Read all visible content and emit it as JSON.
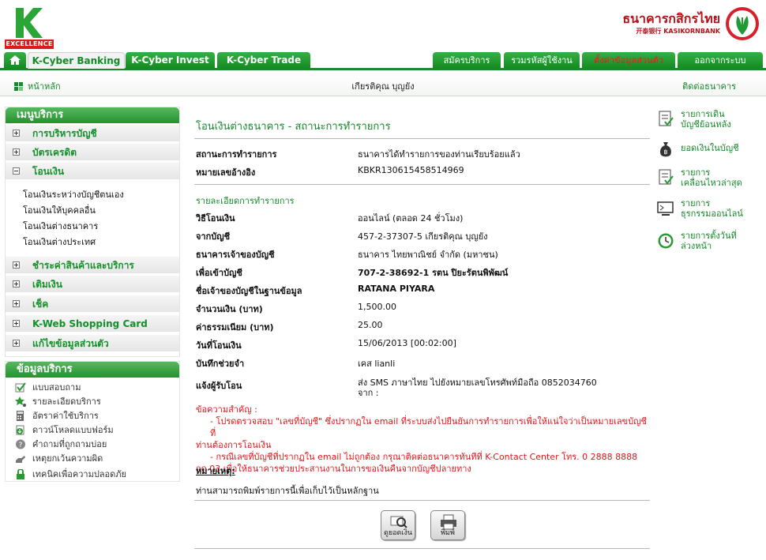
{
  "header": {
    "logo_excellence": "EXCELLENCE",
    "bank_name_th": "ธนาคารกสิกรไทย",
    "bank_name_en": "开泰银行 KASIKORNBANK",
    "colors": {
      "brand_green": "#148a22",
      "accent_red": "#e81c1c"
    }
  },
  "tabs": [
    {
      "label": "K-Cyber Banking"
    },
    {
      "label": "K-Cyber Invest"
    },
    {
      "label": "K-Cyber Trade"
    },
    {
      "label": "สมัครบริการ"
    },
    {
      "label": "รวมรหัสผู้ใช้งาน"
    },
    {
      "label": "ตั้งค่าข้อมูลส่วนตัว"
    },
    {
      "label": "ออกจากระบบ"
    }
  ],
  "subbar": {
    "home": "หน้าหลัก",
    "user_name": "เกียรติคุณ บุญยัง",
    "contact": "ติดต่อธนาคาร"
  },
  "sidebar": {
    "menu_title": "เมนูบริการ",
    "menu": [
      {
        "label": "การบริหารบัญชี",
        "state": "collapsed"
      },
      {
        "label": "บัตรเครดิต",
        "state": "collapsed"
      },
      {
        "label": "โอนเงิน",
        "state": "expanded"
      },
      {
        "label": "ชำระค่าสินค้าและบริการ",
        "state": "collapsed"
      },
      {
        "label": "เติมเงิน",
        "state": "collapsed"
      },
      {
        "label": "เช็ค",
        "state": "collapsed"
      },
      {
        "label": "K-Web Shopping Card",
        "state": "collapsed"
      },
      {
        "label": "แก้ไขข้อมูลส่วนตัว",
        "state": "collapsed"
      }
    ],
    "transfer_sub": [
      "โอนเงินระหว่างบัญชีตนเอง",
      "โอนเงินให้บุคคลอื่น",
      "โอนเงินต่างธนาคาร",
      "โอนเงินต่างประเทศ"
    ],
    "info_title": "ข้อมูลบริการ",
    "info": [
      {
        "label": "แบบสอบถาม",
        "icon": "checkmark-icon"
      },
      {
        "label": "รายละเอียดบริการ",
        "icon": "star-icon"
      },
      {
        "label": "อัตราค่าใช้บริการ",
        "icon": "calculator-icon"
      },
      {
        "label": "ดาวน์โหลดแบบฟอร์ม",
        "icon": "download-icon"
      },
      {
        "label": "คำถามที่ถูกถามบ่อย",
        "icon": "question-icon"
      },
      {
        "label": "เหตุยกเว้นความผิด",
        "icon": "hand-icon"
      },
      {
        "label": "เทคนิคเพื่อความปลอดภัย",
        "icon": "lock-icon"
      }
    ]
  },
  "main": {
    "title": "โอนเงินต่างธนาคาร - สถานะการทำรายการ",
    "status_label": "สถานะการทำรายการ",
    "status_value": "ธนาคารได้ทำรายการของท่านเรียบร้อยแล้ว",
    "ref_label": "หมายเลขอ้างอิง",
    "ref_value": "KBKR130615458514969",
    "details_title": "รายละเอียดการทำรายการ",
    "details": [
      {
        "label": "วิธีโอนเงิน",
        "value": "ออนไลน์ (ตลอด 24 ชั่วโมง)"
      },
      {
        "label": "จากบัญชี",
        "value": "457-2-37307-5 เกียรติคุณ บุญยัง"
      },
      {
        "label": "ธนาคารเจ้าของบัญชี",
        "value": "ธนาคาร ไทยพาณิชย์ จำกัด (มหาชน)"
      },
      {
        "label": "เพื่อเข้าบัญชี",
        "value": "707-2-38692-1 รตน ปิยะรัตนพิพัฒน์"
      },
      {
        "label": "ชื่อเจ้าของบัญชีในฐานข้อมูล",
        "value": "RATANA PIYARA"
      },
      {
        "label": "จำนวนเงิน (บาท)",
        "value": "1,500.00"
      },
      {
        "label": "ค่าธรรมเนียม (บาท)",
        "value": "25.00"
      },
      {
        "label": "วันที่โอนเงิน",
        "value": "15/06/2013 [00:02:00]"
      },
      {
        "label": "บันทึกช่วยจำ",
        "value": "เคส lianli"
      },
      {
        "label": "แจ้งผู้รับโอน",
        "value": "ส่ง SMS ภาษาไทย ไปยังหมายเลขโทรศัพท์มือถือ 0852034760",
        "value2": "จาก :"
      }
    ],
    "warning_head": "ข้อความสำคัญ :",
    "warning_1": "- โปรดตรวจสอบ \"เลขที่บัญชี\" ซึ่งปรากฏใน email ที่ระบบส่งไปยืนยันการทำรายการเพื่อให้แน่ใจว่าเป็นหมายเลขบัญชีที่",
    "warning_1b": "ท่านต้องการโอนเงิน",
    "warning_2": "- กรณีเลขที่บัญชีที่ปรากฏใน email ไม่ถูกต้อง กรุณาติดต่อธนาคารทันทีที่ K-Contact Center โทร. 0 2888 8888",
    "warning_2b": "กด 03 เพื่อให้ธนาคารช่วยประสานงานในการขอเงินคืนจากบัญชีปลายทาง",
    "note_head": "หมายเหตุ:",
    "note_body": "ท่านสามารถพิมพ์รายการนี้เพื่อเก็บไว้เป็นหลักฐาน",
    "btn_check_balance": "ดูยอดเงิน",
    "btn_print": "พิมพ์"
  },
  "quick_links": [
    {
      "line1": "รายการเดิน",
      "line2": "บัญชีย้อนหลัง",
      "icon": "statement-icon"
    },
    {
      "line1": "ยอดเงินในบัญชี",
      "line2": "",
      "icon": "moneybag-icon"
    },
    {
      "line1": "รายการ",
      "line2": "เคลื่อนไหวล่าสุด",
      "icon": "recent-list-icon"
    },
    {
      "line1": "รายการ",
      "line2": "ธุรกรรมออนไลน์",
      "icon": "monitor-icon"
    },
    {
      "line1": "รายการตั้งวันที่",
      "line2": "ล่วงหน้า",
      "icon": "clock-icon"
    }
  ]
}
